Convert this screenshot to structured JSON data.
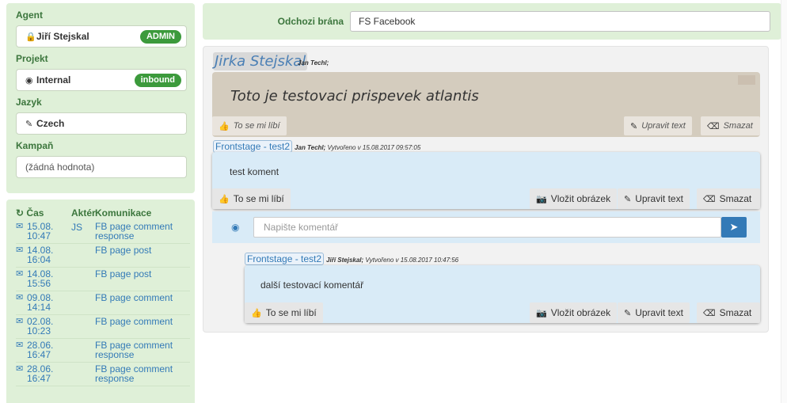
{
  "left": {
    "agent_label": "Agent",
    "agent_name": "Jiří Stejskal",
    "agent_badge": "ADMIN",
    "project_label": "Projekt",
    "project_name": "Internal",
    "project_badge": "inbound",
    "language_label": "Jazyk",
    "language_name": "Czech",
    "campaign_label": "Kampaň",
    "campaign_value": "(žádná hodnota)"
  },
  "history": {
    "col_time": "Čas",
    "col_actor": "Aktér",
    "col_comm": "Komunikace",
    "rows": [
      {
        "d": "15.08.",
        "t": "10:47",
        "actor": "JS",
        "kom": "FB page comment response"
      },
      {
        "d": "14.08.",
        "t": "16:04",
        "actor": "",
        "kom": "FB page post"
      },
      {
        "d": "14.08.",
        "t": "15:56",
        "actor": "",
        "kom": "FB page post"
      },
      {
        "d": "09.08.",
        "t": "14:14",
        "actor": "",
        "kom": "FB page comment"
      },
      {
        "d": "02.08.",
        "t": "10:23",
        "actor": "",
        "kom": "FB page comment"
      },
      {
        "d": "28.06.",
        "t": "16:47",
        "actor": "",
        "kom": "FB page comment response"
      },
      {
        "d": "28.06.",
        "t": "16:47",
        "actor": "",
        "kom": "FB page comment response"
      }
    ]
  },
  "gate": {
    "label": "Odchozi brána",
    "value": "FS Facebook"
  },
  "post": {
    "author": "Jirka Stejskal",
    "meta": "Jan Techl;",
    "text": "Toto je testovaci prispevek atlantis",
    "like": "To se mi líbí",
    "edit": "Upravit text",
    "delete": "Smazat"
  },
  "comment1": {
    "source": "Frontstage - test2",
    "meta_bold": "Jan Techl;",
    "meta": " Vytvořeno v 15.08.2017 09:57:05",
    "text": "test koment",
    "like": "To se mi líbí",
    "image": "Vložit obrázek",
    "edit": "Upravit text",
    "delete": "Smazat"
  },
  "reply": {
    "placeholder": "Napište komentář"
  },
  "comment2": {
    "source": "Frontstage - test2",
    "meta_bold": "Jiří Stejskal;",
    "meta": " Vytvořeno v 15.08.2017 10:47:56",
    "text": "další testovací komentář",
    "like": "To se mi líbí",
    "image": "Vložit obrázek",
    "edit": "Upravit text",
    "delete": "Smazat"
  }
}
